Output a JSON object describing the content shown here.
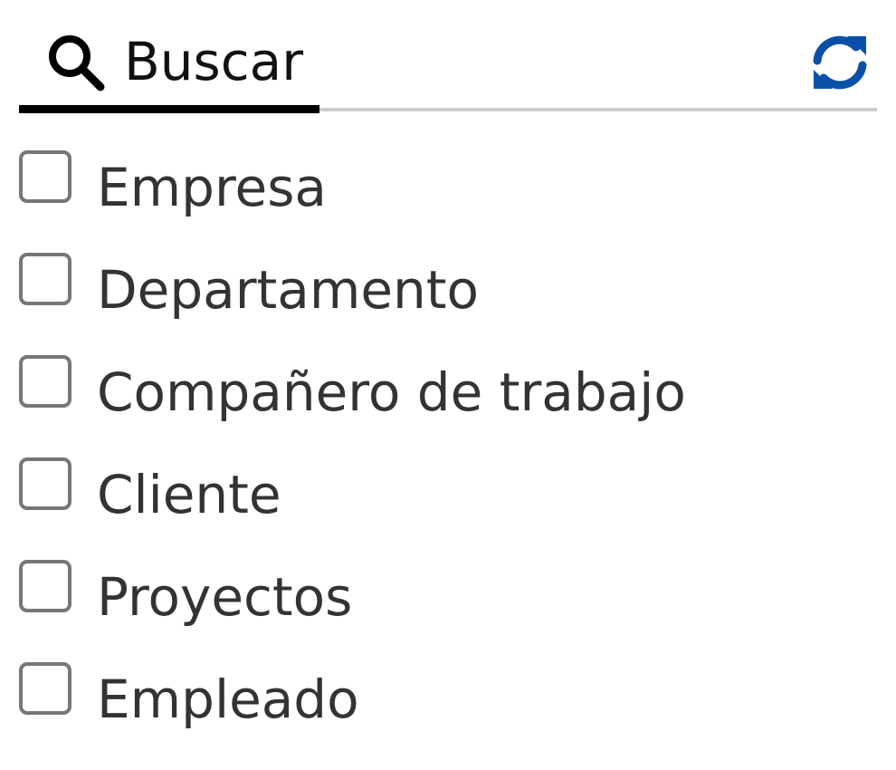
{
  "search": {
    "placeholder": "Buscar",
    "icon": "search-icon"
  },
  "refresh": {
    "icon": "refresh-icon",
    "color": "#0b50a8"
  },
  "options": [
    {
      "label": "Empresa",
      "checked": false
    },
    {
      "label": "Departamento",
      "checked": false
    },
    {
      "label": "Compañero de trabajo",
      "checked": false
    },
    {
      "label": "Cliente",
      "checked": false
    },
    {
      "label": "Proyectos",
      "checked": false
    },
    {
      "label": "Empleado",
      "checked": false
    }
  ]
}
